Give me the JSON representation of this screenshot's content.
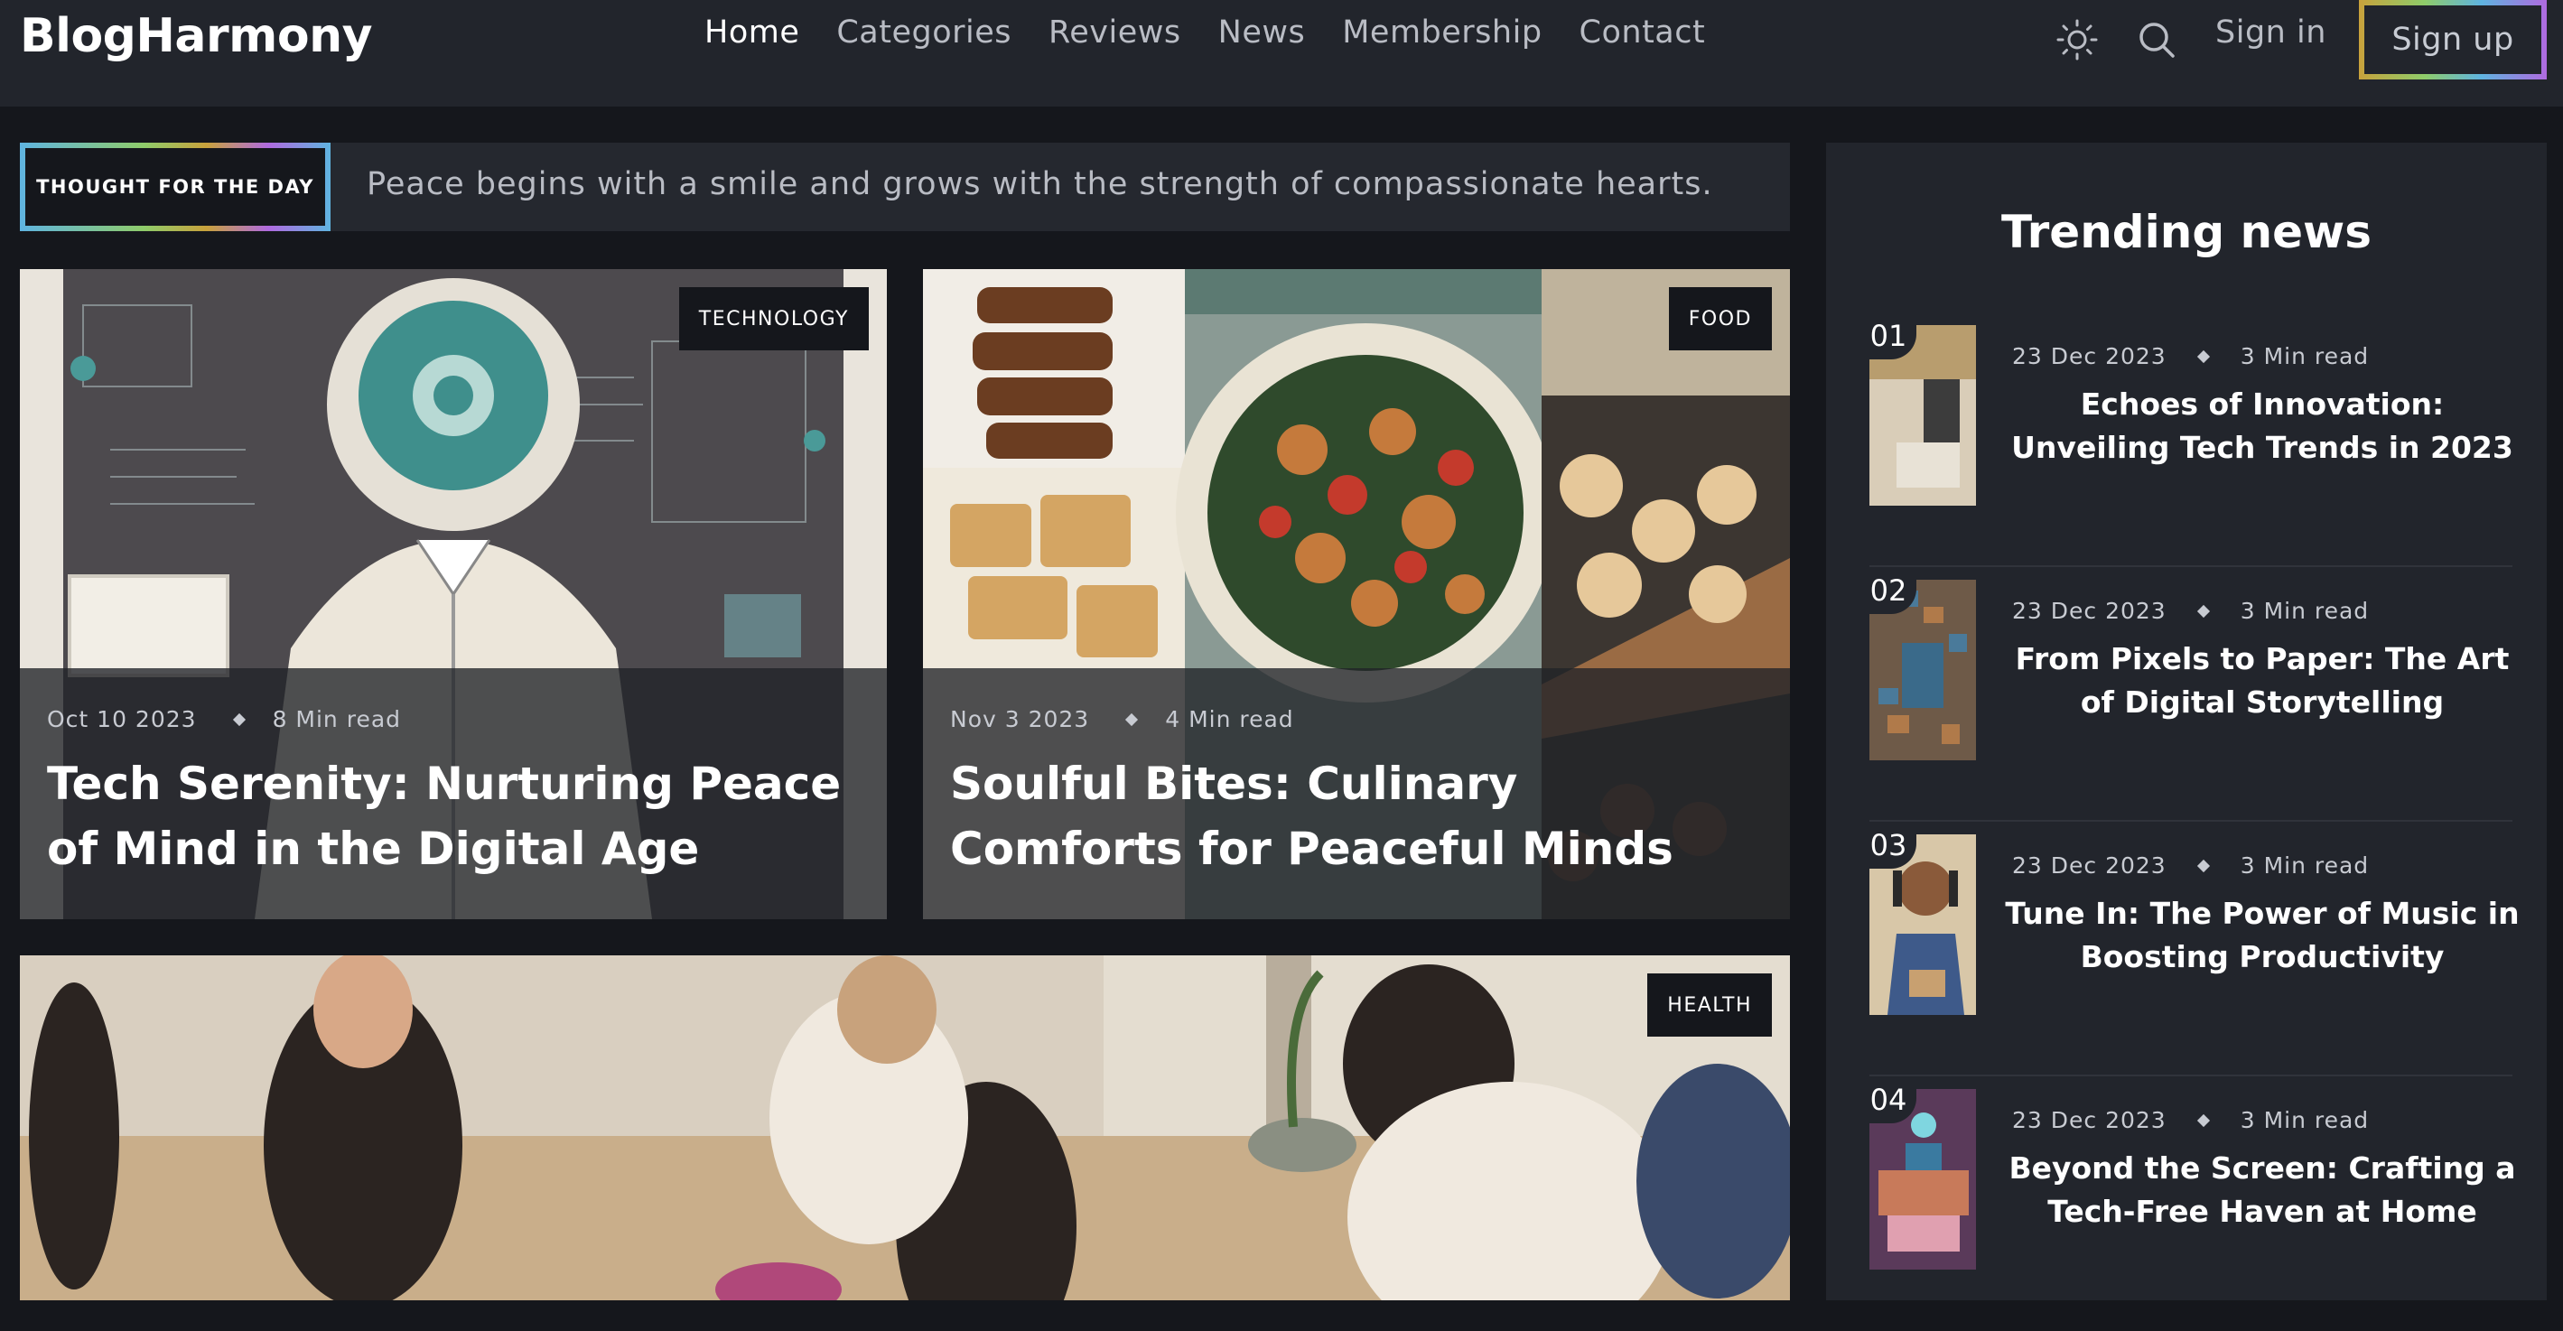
{
  "header": {
    "logo": "BlogHarmony",
    "nav": [
      "Home",
      "Categories",
      "Reviews",
      "News",
      "Membership",
      "Contact"
    ],
    "active_nav": "Home",
    "icons": [
      "sun-icon",
      "search-icon"
    ],
    "signin": "Sign in",
    "signup": "Sign up"
  },
  "thought": {
    "label": "THOUGHT FOR THE DAY",
    "text": "Peace begins with a smile and grows with the strength of compassionate hearts."
  },
  "featured": [
    {
      "category": "TECHNOLOGY",
      "date": "Oct 10 2023",
      "read": "8 Min read",
      "title": "Tech Serenity: Nurturing Peace of Mind in the Digital Age"
    },
    {
      "category": "FOOD",
      "date": "Nov 3 2023",
      "read": "4 Min read",
      "title": "Soulful Bites: Culinary Comforts for Peaceful Minds"
    },
    {
      "category": "HEALTH"
    }
  ],
  "trending": {
    "title": "Trending news",
    "items": [
      {
        "num": "01",
        "date": "23 Dec 2023",
        "read": "3 Min read",
        "title": "Echoes of Innovation: Unveiling Tech Trends in 2023"
      },
      {
        "num": "02",
        "date": "23 Dec 2023",
        "read": "3 Min read",
        "title": "From Pixels to Paper: The Art of Digital Storytelling"
      },
      {
        "num": "03",
        "date": "23 Dec 2023",
        "read": "3 Min read",
        "title": "Tune In: The Power of Music in Boosting Productivity"
      },
      {
        "num": "04",
        "date": "23 Dec 2023",
        "read": "3 Min read",
        "title": "Beyond the Screen: Crafting a Tech-Free Haven at Home"
      }
    ]
  },
  "colors": {
    "background": "#15171c",
    "header": "#22252c",
    "panel": "#25282f",
    "accent_gradient": [
      "#c8a23c",
      "#8fcc6a",
      "#5fb4e0",
      "#b06ae0"
    ]
  }
}
